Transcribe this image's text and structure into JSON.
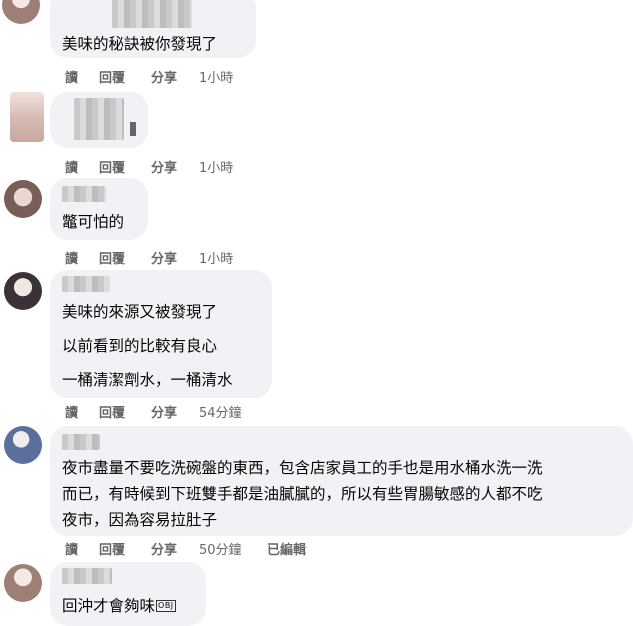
{
  "actions": {
    "read": "讀",
    "reply": "回覆",
    "share": "分享",
    "edited": "已編輯"
  },
  "comments": [
    {
      "lines": [
        "美味的秘訣被你發現了"
      ],
      "time": "1小時"
    },
    {
      "lines": [],
      "time": "1小時"
    },
    {
      "lines": [
        "鼈可怕的"
      ],
      "time": "1小時"
    },
    {
      "lines": [
        "美味的來源又被發現了",
        "以前看到的比較有良心",
        "一桶清潔劑水，一桶清水"
      ],
      "time": "54分鐘"
    },
    {
      "lines": [
        "夜市盡量不要吃洗碗盤的東西，包含店家員工的手也是用水桶水洗一洗",
        "而已，有時候到下班雙手都是油膩膩的，所以有些胃腸敏感的人都不吃",
        "夜市，因為容易拉肚子"
      ],
      "time": "50分鐘"
    },
    {
      "lines": [
        "回沖才會夠味"
      ],
      "time": "",
      "obj": "OBJ"
    }
  ]
}
